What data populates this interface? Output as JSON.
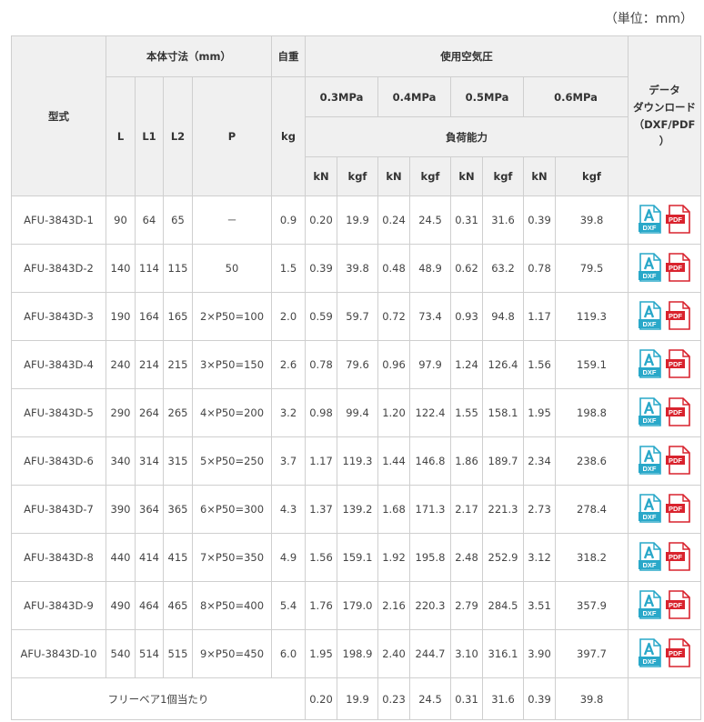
{
  "unit_note": "（単位：mm）",
  "headers": {
    "model": "型式",
    "body_dimensions": "本体寸法（mm）",
    "weight": "自重",
    "air_pressure": "使用空気圧",
    "download": "データ\nダウンロード\n（DXF/PDF\n）",
    "L": "L",
    "L1": "L1",
    "L2": "L2",
    "P": "P",
    "kg": "kg",
    "pressures": [
      "0.3MPa",
      "0.4MPa",
      "0.5MPa",
      "0.6MPa"
    ],
    "load_capacity": "負荷能力",
    "kN": "kN",
    "kgf": "kgf"
  },
  "rows": [
    {
      "model": "AFU-3843D-1",
      "L": "90",
      "L1": "64",
      "L2": "65",
      "P": "－",
      "kg": "0.9",
      "loads": [
        "0.20",
        "19.9",
        "0.24",
        "24.5",
        "0.31",
        "31.6",
        "0.39",
        "39.8"
      ]
    },
    {
      "model": "AFU-3843D-2",
      "L": "140",
      "L1": "114",
      "L2": "115",
      "P": "50",
      "kg": "1.5",
      "loads": [
        "0.39",
        "39.8",
        "0.48",
        "48.9",
        "0.62",
        "63.2",
        "0.78",
        "79.5"
      ]
    },
    {
      "model": "AFU-3843D-3",
      "L": "190",
      "L1": "164",
      "L2": "165",
      "P": "2×P50=100",
      "kg": "2.0",
      "loads": [
        "0.59",
        "59.7",
        "0.72",
        "73.4",
        "0.93",
        "94.8",
        "1.17",
        "119.3"
      ]
    },
    {
      "model": "AFU-3843D-4",
      "L": "240",
      "L1": "214",
      "L2": "215",
      "P": "3×P50=150",
      "kg": "2.6",
      "loads": [
        "0.78",
        "79.6",
        "0.96",
        "97.9",
        "1.24",
        "126.4",
        "1.56",
        "159.1"
      ]
    },
    {
      "model": "AFU-3843D-5",
      "L": "290",
      "L1": "264",
      "L2": "265",
      "P": "4×P50=200",
      "kg": "3.2",
      "loads": [
        "0.98",
        "99.4",
        "1.20",
        "122.4",
        "1.55",
        "158.1",
        "1.95",
        "198.8"
      ]
    },
    {
      "model": "AFU-3843D-6",
      "L": "340",
      "L1": "314",
      "L2": "315",
      "P": "5×P50=250",
      "kg": "3.7",
      "loads": [
        "1.17",
        "119.3",
        "1.44",
        "146.8",
        "1.86",
        "189.7",
        "2.34",
        "238.6"
      ]
    },
    {
      "model": "AFU-3843D-7",
      "L": "390",
      "L1": "364",
      "L2": "365",
      "P": "6×P50=300",
      "kg": "4.3",
      "loads": [
        "1.37",
        "139.2",
        "1.68",
        "171.3",
        "2.17",
        "221.3",
        "2.73",
        "278.4"
      ]
    },
    {
      "model": "AFU-3843D-8",
      "L": "440",
      "L1": "414",
      "L2": "415",
      "P": "7×P50=350",
      "kg": "4.9",
      "loads": [
        "1.56",
        "159.1",
        "1.92",
        "195.8",
        "2.48",
        "252.9",
        "3.12",
        "318.2"
      ]
    },
    {
      "model": "AFU-3843D-9",
      "L": "490",
      "L1": "464",
      "L2": "465",
      "P": "8×P50=400",
      "kg": "5.4",
      "loads": [
        "1.76",
        "179.0",
        "2.16",
        "220.3",
        "2.79",
        "284.5",
        "3.51",
        "357.9"
      ]
    },
    {
      "model": "AFU-3843D-10",
      "L": "540",
      "L1": "514",
      "L2": "515",
      "P": "9×P50=450",
      "kg": "6.0",
      "loads": [
        "1.95",
        "198.9",
        "2.40",
        "244.7",
        "3.10",
        "316.1",
        "3.90",
        "397.7"
      ]
    }
  ],
  "footer": {
    "label": "フリーベア1個当たり",
    "loads": [
      "0.20",
      "19.9",
      "0.23",
      "24.5",
      "0.31",
      "31.6",
      "0.39",
      "39.8"
    ]
  },
  "icons": {
    "dxf_icon": "dxf-file-icon",
    "pdf_icon": "pdf-file-icon",
    "dxf_text": "DXF",
    "pdf_text": "PDF",
    "dxf_color": "#29a8c9",
    "pdf_color": "#d9232e"
  }
}
